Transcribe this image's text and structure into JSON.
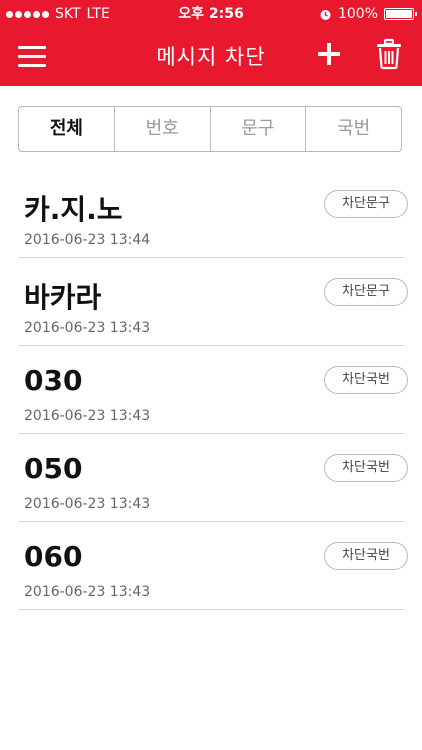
{
  "status_bar": {
    "carrier": "SKT",
    "network": "LTE",
    "time": "오후 2:56",
    "battery": "100%"
  },
  "header": {
    "title": "메시지 차단"
  },
  "tabs": [
    {
      "label": "전체"
    },
    {
      "label": "번호"
    },
    {
      "label": "문구"
    },
    {
      "label": "국번"
    }
  ],
  "items": [
    {
      "text": "카.지.노",
      "date": "2016-06-23 13:44",
      "badge": "차단문구"
    },
    {
      "text": "바카라",
      "date": "2016-06-23 13:43",
      "badge": "차단문구"
    },
    {
      "text": "030",
      "date": "2016-06-23 13:43",
      "badge": "차단국번"
    },
    {
      "text": "050",
      "date": "2016-06-23 13:43",
      "badge": "차단국번"
    },
    {
      "text": "060",
      "date": "2016-06-23 13:43",
      "badge": "차단국번"
    }
  ],
  "colors": {
    "header_bg": "#e8182e"
  },
  "icons": {
    "menu": "hamburger-menu-icon",
    "add": "plus-icon",
    "delete": "trash-icon"
  }
}
